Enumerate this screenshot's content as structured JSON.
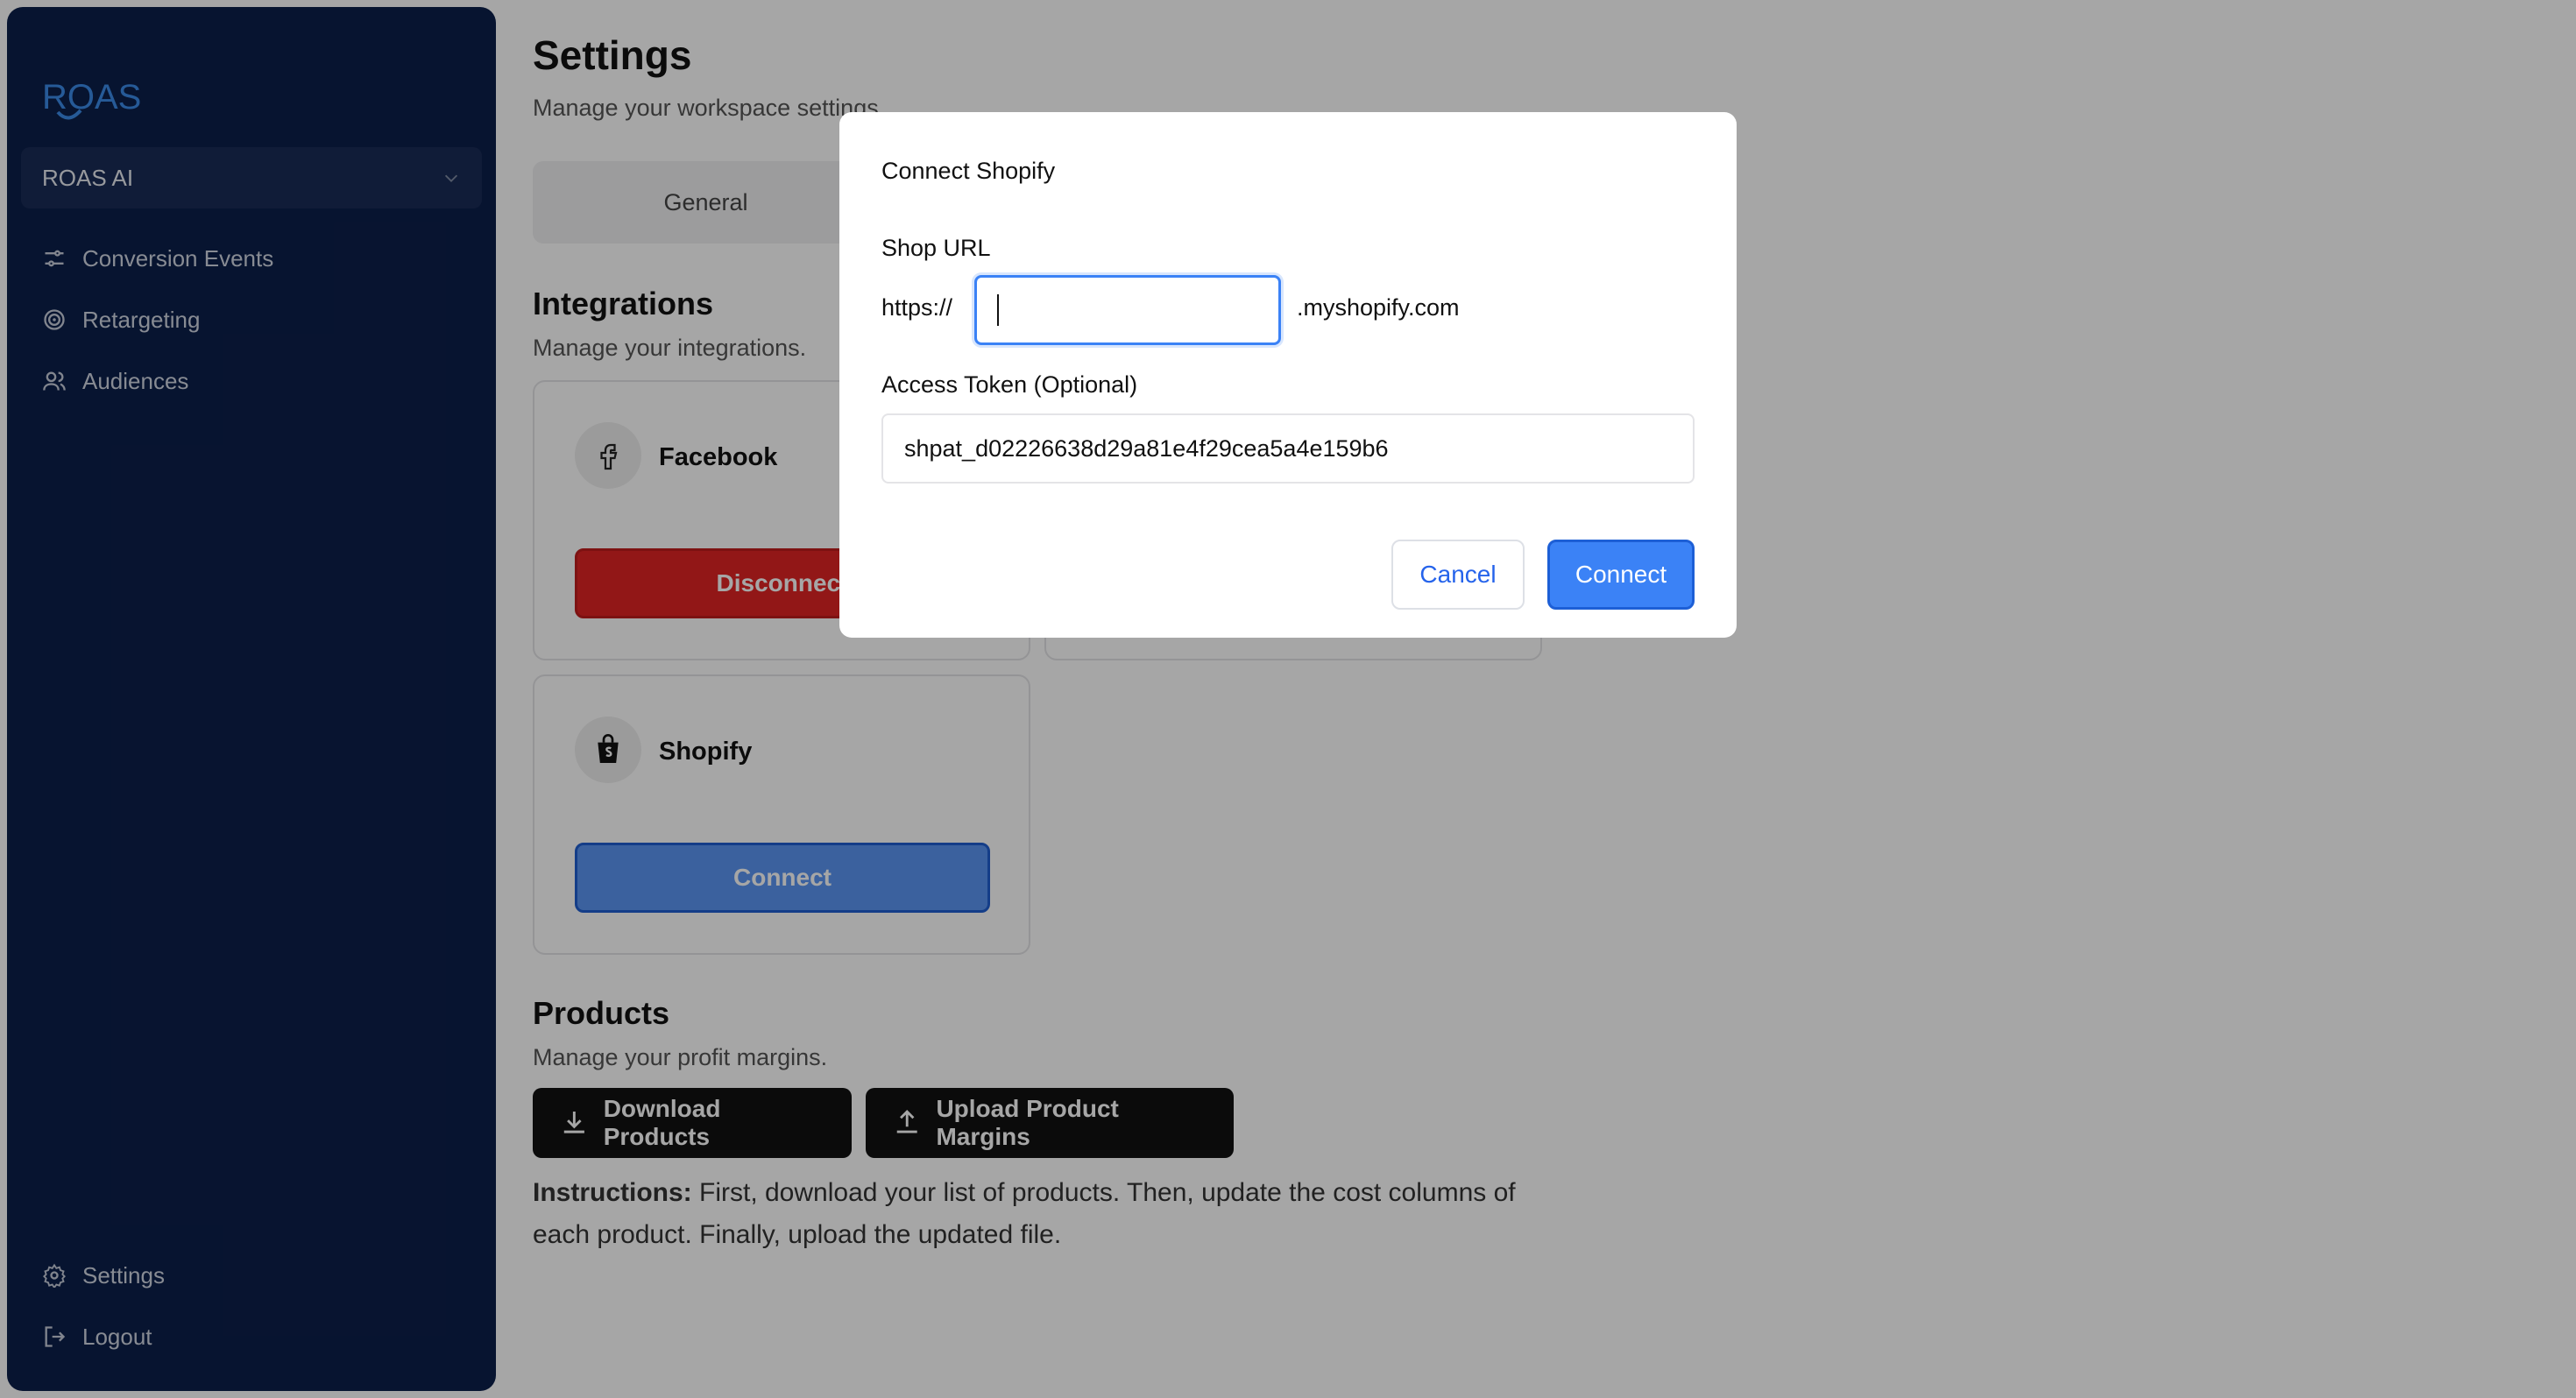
{
  "sidebar": {
    "brand": "ROAS",
    "workspace": "ROAS AI",
    "nav": [
      {
        "label": "Conversion Events",
        "icon": "sliders-icon"
      },
      {
        "label": "Retargeting",
        "icon": "target-icon"
      },
      {
        "label": "Audiences",
        "icon": "users-icon"
      }
    ],
    "bottom_nav": [
      {
        "label": "Settings",
        "icon": "gear-icon"
      },
      {
        "label": "Logout",
        "icon": "logout-icon"
      }
    ]
  },
  "page": {
    "title": "Settings",
    "subtitle": "Manage your workspace settings.",
    "tabs": [
      "General"
    ]
  },
  "integrations": {
    "title": "Integrations",
    "subtitle": "Manage your integrations.",
    "cards": [
      {
        "name": "Facebook",
        "button": "Disconnect",
        "icon": "facebook-icon"
      },
      {
        "name": "Shopify",
        "button": "Connect",
        "icon": "shopify-icon"
      }
    ]
  },
  "products": {
    "title": "Products",
    "subtitle": "Manage your profit margins.",
    "download_label": "Download Products",
    "upload_label": "Upload Product Margins",
    "instructions_label": "Instructions:",
    "instructions_text": "First, download your list of products. Then, update the cost columns of each product. Finally, upload the updated file."
  },
  "modal": {
    "title": "Connect Shopify",
    "shop_url_label": "Shop URL",
    "url_prefix": "https://",
    "url_value": "",
    "url_suffix": ".myshopify.com",
    "token_label": "Access Token (Optional)",
    "token_value": "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",
    "cancel_label": "Cancel",
    "connect_label": "Connect"
  },
  "colors": {
    "sidebar_bg": "#0c1f4a",
    "accent_blue": "#3b82f6",
    "danger_red": "#e02424",
    "brand_blue": "#3b8be8"
  }
}
